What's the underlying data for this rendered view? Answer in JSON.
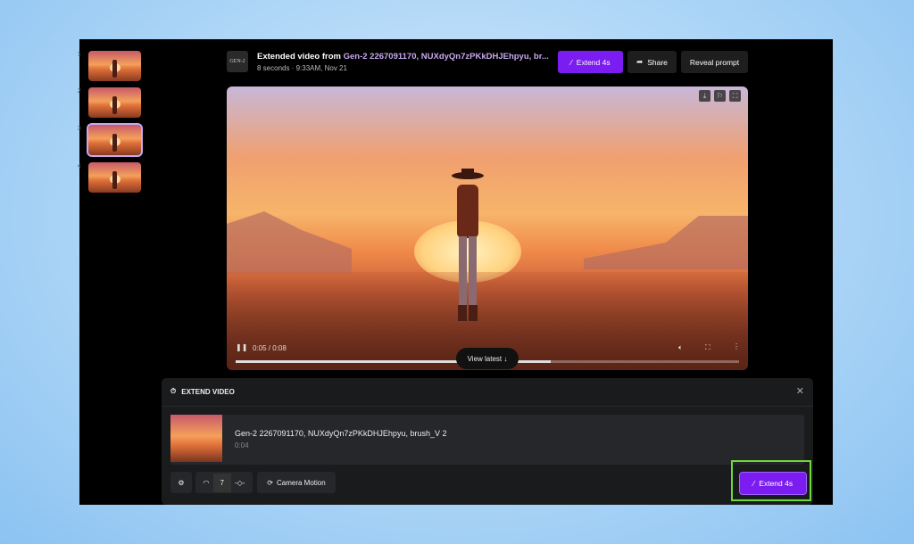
{
  "sidebar": {
    "thumbnails": [
      {
        "num": "1"
      },
      {
        "num": "2"
      },
      {
        "num": "3",
        "selected": true
      },
      {
        "num": "4"
      }
    ]
  },
  "header": {
    "logo": "GEN-2",
    "title_prefix": "Extended video from ",
    "title_link": "Gen-2 2267091170, NUXdyQn7zPKkDHJEhpyu, br...",
    "subtitle": "8 seconds · 9:33AM, Nov 21",
    "extend_label": "Extend 4s",
    "share_label": "Share",
    "reveal_label": "Reveal prompt"
  },
  "player": {
    "time": "0:05 / 0:08",
    "progress": 0.625,
    "view_latest": "View latest ↓"
  },
  "extend_panel": {
    "title": "EXTEND VIDEO",
    "clip_title": "Gen-2 2267091170, NUXdyQn7zPKkDHJEhpyu, brush_V 2",
    "clip_duration": "0:04",
    "motion_value": "7",
    "camera_motion_label": "Camera Motion",
    "extend_label": "Extend 4s"
  },
  "colors": {
    "accent": "#7b1cf0",
    "highlight": "#6fd83a"
  }
}
